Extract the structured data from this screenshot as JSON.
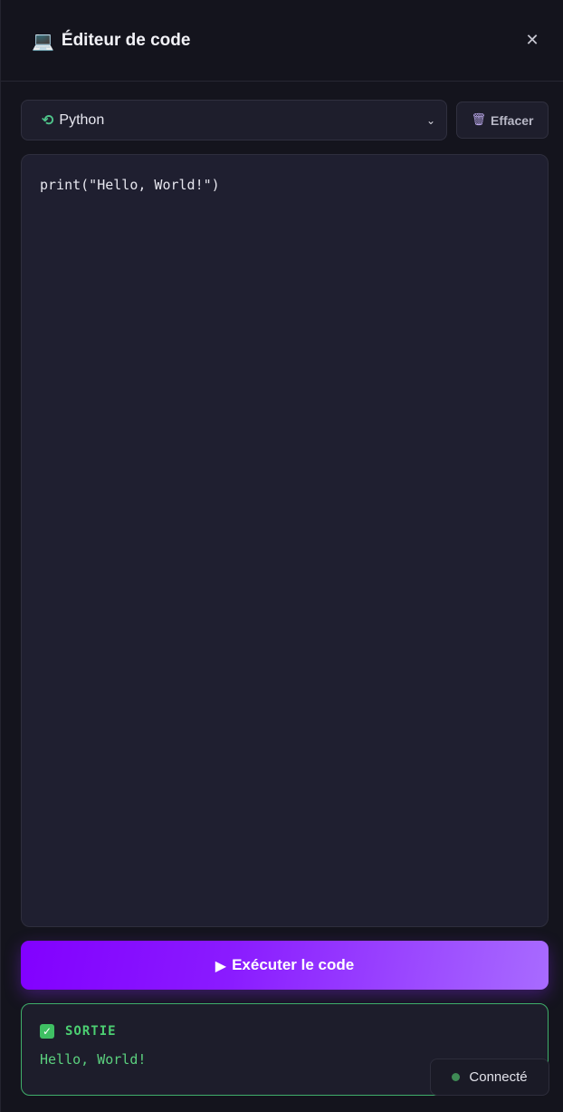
{
  "header": {
    "emoji": "💻",
    "title": "Éditeur de code",
    "close": "✕"
  },
  "toolbar": {
    "language": {
      "icon": "python-icon",
      "glyph": "⟲",
      "selected": "Python",
      "chevron": "⌄"
    },
    "clear": {
      "icon": "trash-icon",
      "glyph": "🗑",
      "label": "Effacer"
    }
  },
  "editor": {
    "code": "print(\"Hello, World!\")"
  },
  "run": {
    "icon": "play-icon",
    "glyph": "▶",
    "label": "Exécuter le code"
  },
  "output": {
    "icon": "check-icon",
    "glyph": "✓",
    "title": "SORTIE",
    "text": "Hello, World!"
  },
  "status": {
    "label": "Connecté",
    "color": "#3f8a55"
  },
  "colors": {
    "accent": "#8a1bff",
    "success": "#4ccf72",
    "background": "#14141d"
  }
}
